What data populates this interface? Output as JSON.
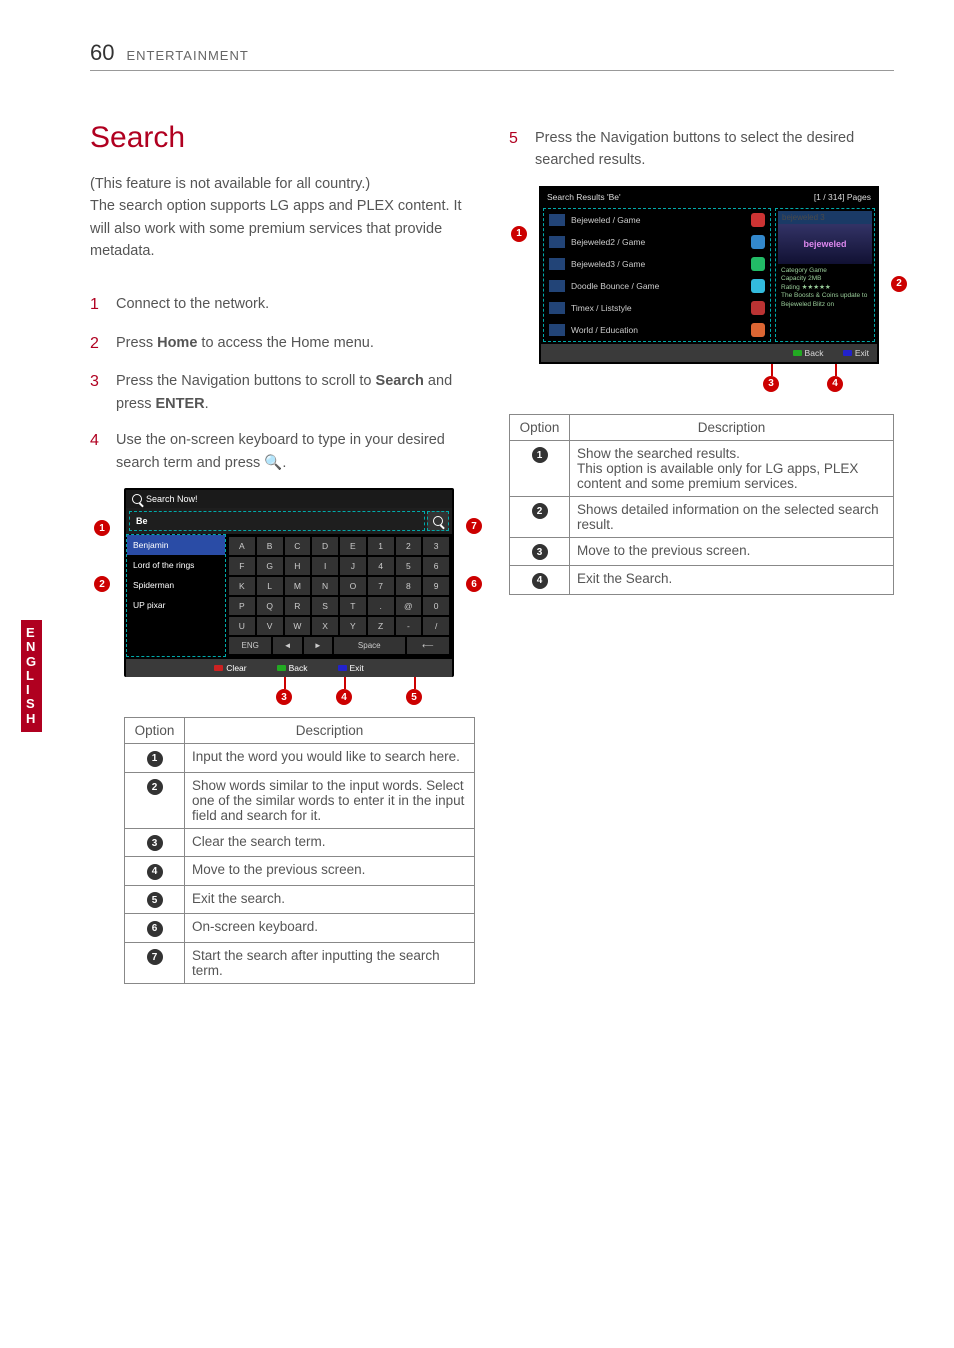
{
  "header": {
    "page_number": "60",
    "section": "ENTERTAINMENT"
  },
  "side_tab": "ENGLISH",
  "title": "Search",
  "intro": "(This feature is not available for all country.)\nThe search option supports LG apps and PLEX content. It will also work with some premium services that provide metadata.",
  "steps_left": [
    {
      "n": "1",
      "text": "Connect to the network."
    },
    {
      "n": "2",
      "text_pre": "Press ",
      "bold1": "Home",
      "text_post": " to access the Home menu."
    },
    {
      "n": "3",
      "text_pre": "Press the Navigation buttons to scroll to ",
      "bold1": "Search",
      "mid": " and press ",
      "bold2": "ENTER",
      "end": "."
    },
    {
      "n": "4",
      "text": "Use the on-screen keyboard to type in your desired search term and press 🔍."
    }
  ],
  "screenshot_left": {
    "title": "Search Now!",
    "input_value": "Be",
    "suggestions": [
      "Benjamin",
      "Lord of the rings",
      "Spiderman",
      "UP pixar"
    ],
    "keys_row1": [
      "A",
      "B",
      "C",
      "D",
      "E",
      "1",
      "2",
      "3"
    ],
    "keys_row2": [
      "F",
      "G",
      "H",
      "I",
      "J",
      "4",
      "5",
      "6"
    ],
    "keys_row3": [
      "K",
      "L",
      "M",
      "N",
      "O",
      "7",
      "8",
      "9"
    ],
    "keys_row4": [
      "P",
      "Q",
      "R",
      "S",
      "T",
      ".",
      "@",
      "0"
    ],
    "keys_row5": [
      "U",
      "V",
      "W",
      "X",
      "Y",
      "Z",
      "-",
      "/"
    ],
    "kb_bottom": [
      "ENG",
      "◄",
      "►",
      "Space",
      "⟵"
    ],
    "footer": {
      "clear": "Clear",
      "back": "Back",
      "exit": "Exit"
    }
  },
  "table_left": {
    "head_option": "Option",
    "head_desc": "Description",
    "rows": [
      {
        "n": "1",
        "d": "Input the word you would like to search here."
      },
      {
        "n": "2",
        "d": "Show words similar to the input words. Select one of the similar words to enter it in the input field and search for it."
      },
      {
        "n": "3",
        "d": "Clear the search term."
      },
      {
        "n": "4",
        "d": "Move to the previous screen."
      },
      {
        "n": "5",
        "d": "Exit the search."
      },
      {
        "n": "6",
        "d": "On-screen keyboard."
      },
      {
        "n": "7",
        "d": "Start the search after inputting the search term."
      }
    ]
  },
  "steps_right": [
    {
      "n": "5",
      "text": "Press the Navigation buttons to select the desired searched results."
    }
  ],
  "screenshot_right": {
    "header_title": "Search Results 'Be'",
    "header_page": "[1 / 314] Pages",
    "results": [
      {
        "label": "Bejeweled / Game",
        "color": "#c33"
      },
      {
        "label": "Bejeweled2 / Game",
        "color": "#38c"
      },
      {
        "label": "Bejeweled3 / Game",
        "color": "#2b6"
      },
      {
        "label": "Doodle Bounce / Game",
        "color": "#3bd"
      },
      {
        "label": "Timex / Liststyle",
        "color": "#b33"
      },
      {
        "label": "World / Education",
        "color": "#d63"
      }
    ],
    "detail": {
      "title": "bejeweled 3",
      "brand": "bejeweled",
      "meta_lines": [
        "Category Game",
        "Capacity 2MB",
        "Rating ★★★★★",
        "The Boosts & Coins update to Bejeweled Blitz on"
      ]
    },
    "footer": {
      "back": "Back",
      "exit": "Exit"
    }
  },
  "table_right": {
    "head_option": "Option",
    "head_desc": "Description",
    "rows": [
      {
        "n": "1",
        "d": "Show the searched results.\nThis option is available only for LG apps, PLEX content and some premium services."
      },
      {
        "n": "2",
        "d": "Shows detailed information on the selected search result."
      },
      {
        "n": "3",
        "d": "Move to the previous screen."
      },
      {
        "n": "4",
        "d": "Exit the Search."
      }
    ]
  }
}
